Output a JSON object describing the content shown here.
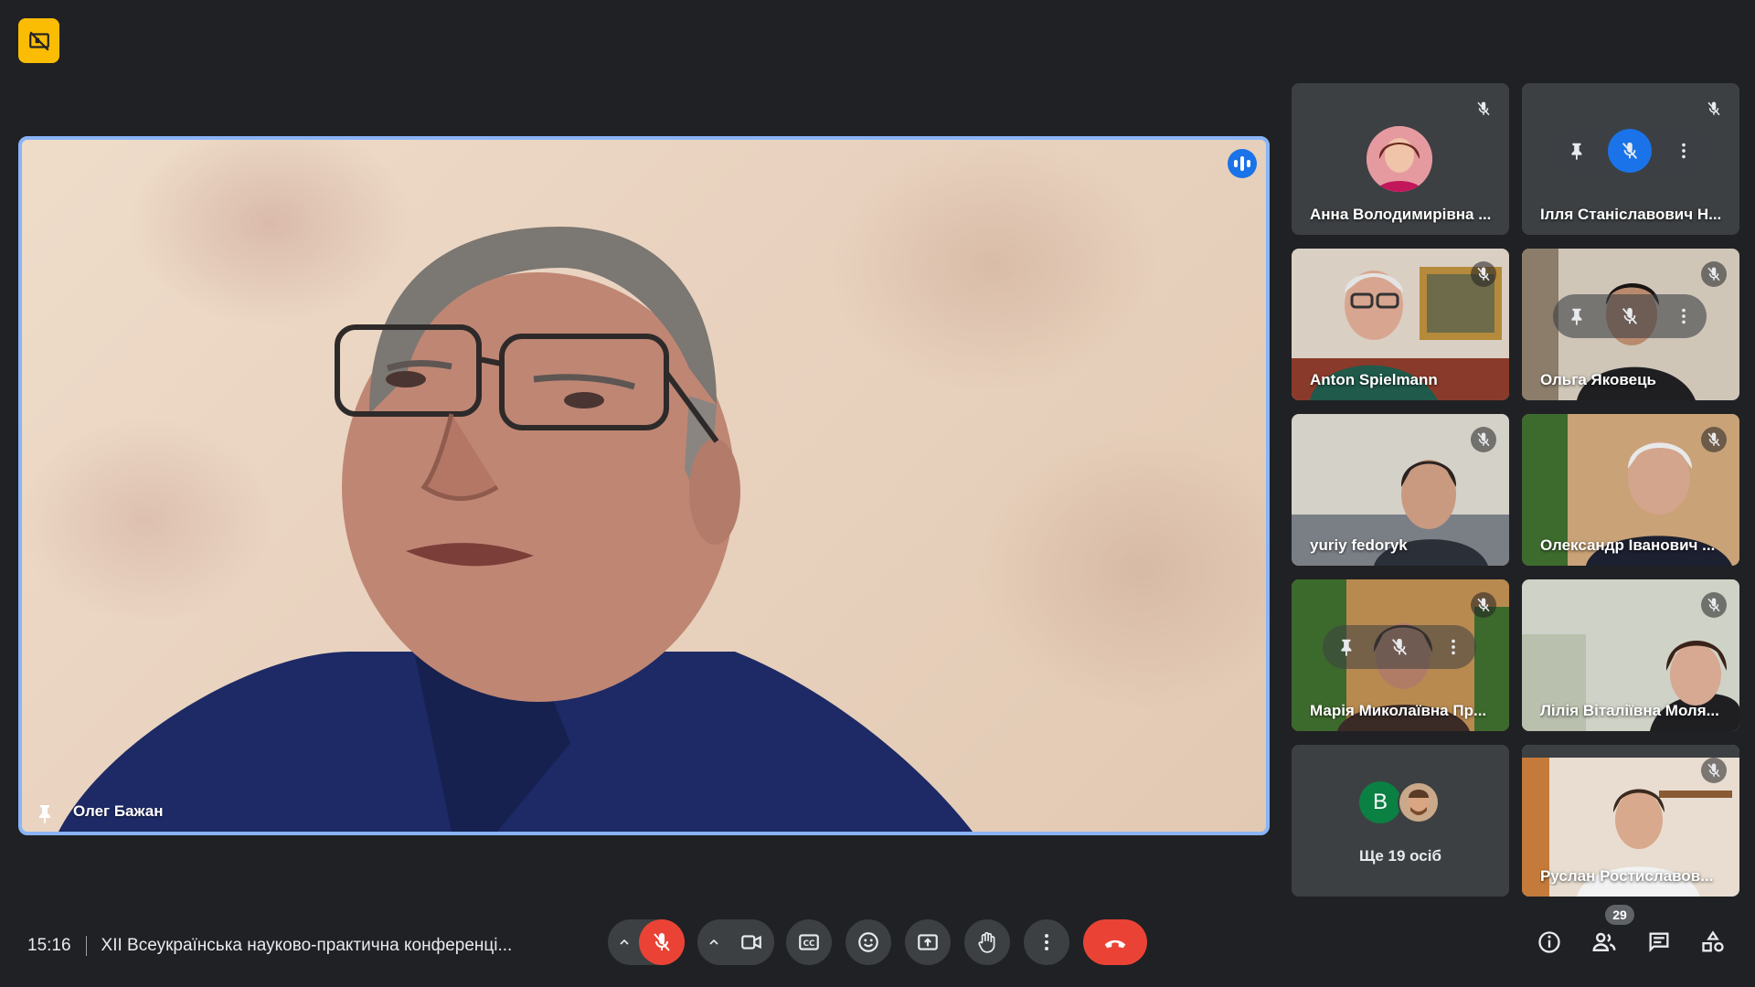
{
  "top_badge": {
    "icon": "no-video-presentation-icon"
  },
  "main": {
    "name": "Олег Бажан",
    "pinned": true
  },
  "grid": [
    {
      "name": "Анна Володимирівна ...",
      "kind": "avatar"
    },
    {
      "name": "Ілля Станіславович Н...",
      "kind": "hover"
    },
    {
      "name": "Anton Spielmann",
      "kind": "video"
    },
    {
      "name": "Ольга Яковець",
      "kind": "video-hover"
    },
    {
      "name": "yuriy fedoryk",
      "kind": "video"
    },
    {
      "name": "Олександр Іванович ...",
      "kind": "video"
    },
    {
      "name": "Марія Миколаївна Пр...",
      "kind": "video-hover"
    },
    {
      "name": "Лілія Віталіївна Моля...",
      "kind": "video"
    },
    {
      "name": "Ще 19 осіб",
      "kind": "more",
      "avatar_letter": "B"
    },
    {
      "name": "Руслан Ростиславов...",
      "kind": "video"
    }
  ],
  "footer": {
    "time": "15:16",
    "meeting_title": "XII Всеукраїнська науково-практична конференці...",
    "participants_count": "29"
  },
  "colors": {
    "background": "#202124",
    "tile": "#3c4043",
    "accent_blue": "#1a73e8",
    "speaking_border": "#8ab4f8",
    "danger_red": "#ea4335",
    "present_badge": "#fbbc04"
  }
}
